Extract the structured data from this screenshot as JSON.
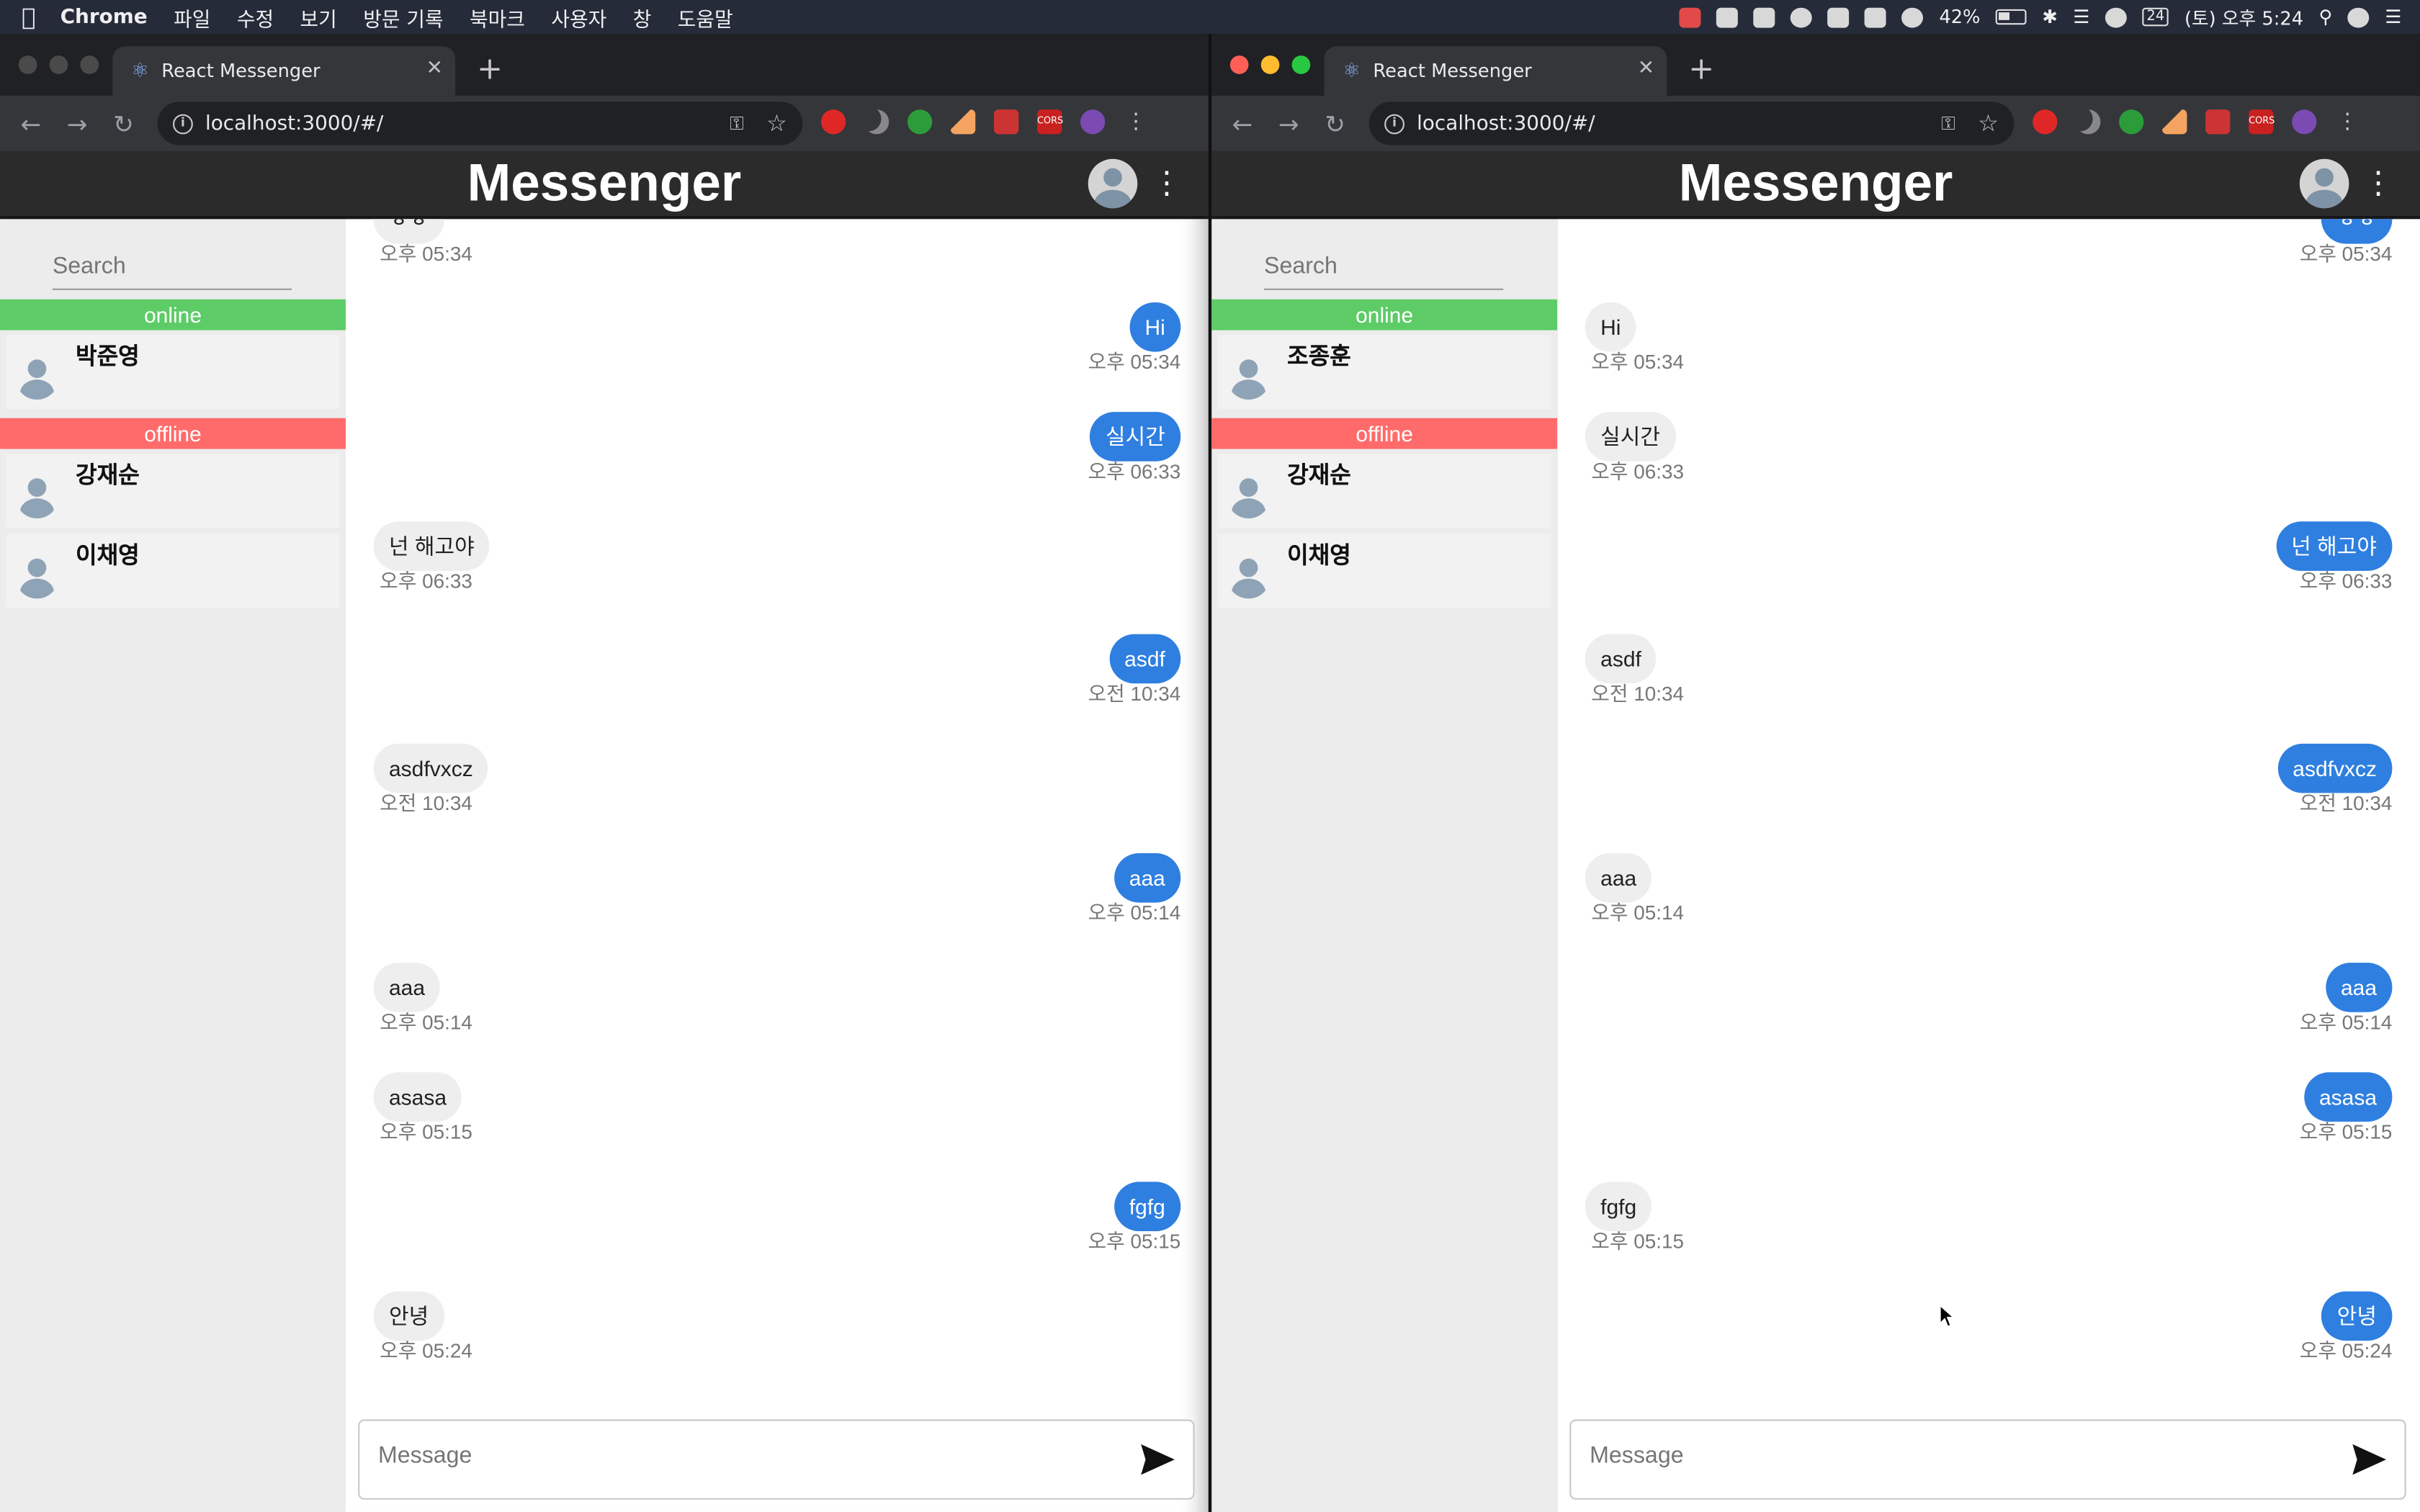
{
  "menubar": {
    "app_name": "Chrome",
    "items": [
      "파일",
      "수정",
      "보기",
      "방문 기록",
      "북마크",
      "사용자",
      "창",
      "도움말"
    ],
    "battery": "42%",
    "clock": "(토) 오후 5:24",
    "calendar_day": "24"
  },
  "windows": [
    {
      "tab_title": "React Messenger",
      "url": "localhost:3000/#/",
      "app_title": "Messenger",
      "search_placeholder": "Search",
      "online_label": "online",
      "offline_label": "offline",
      "online_contacts": [
        "박준영"
      ],
      "offline_contacts": [
        "강재순",
        "이채영"
      ],
      "composer_placeholder": "Message",
      "messages": [
        {
          "text": "ㅎㅎ",
          "time": "오후 05:34",
          "side": "recv"
        },
        {
          "text": "Hi",
          "time": "오후 05:34",
          "side": "sent"
        },
        {
          "text": "실시간",
          "time": "오후 06:33",
          "side": "sent"
        },
        {
          "text": "넌 해고야",
          "time": "오후 06:33",
          "side": "recv"
        },
        {
          "text": "asdf",
          "time": "오전 10:34",
          "side": "sent"
        },
        {
          "text": "asdfvxcz",
          "time": "오전 10:34",
          "side": "recv"
        },
        {
          "text": "aaa",
          "time": "오후 05:14",
          "side": "sent"
        },
        {
          "text": "aaa",
          "time": "오후 05:14",
          "side": "recv"
        },
        {
          "text": "asasa",
          "time": "오후 05:15",
          "side": "recv"
        },
        {
          "text": "fgfg",
          "time": "오후 05:15",
          "side": "sent"
        },
        {
          "text": "안녕",
          "time": "오후 05:24",
          "side": "recv"
        }
      ]
    },
    {
      "tab_title": "React Messenger",
      "url": "localhost:3000/#/",
      "app_title": "Messenger",
      "search_placeholder": "Search",
      "online_label": "online",
      "offline_label": "offline",
      "online_contacts": [
        "조종훈"
      ],
      "offline_contacts": [
        "강재순",
        "이채영"
      ],
      "composer_placeholder": "Message",
      "messages": [
        {
          "text": "ㅎㅎ",
          "time": "오후 05:34",
          "side": "sent"
        },
        {
          "text": "Hi",
          "time": "오후 05:34",
          "side": "recv"
        },
        {
          "text": "실시간",
          "time": "오후 06:33",
          "side": "recv"
        },
        {
          "text": "넌 해고야",
          "time": "오후 06:33",
          "side": "sent"
        },
        {
          "text": "asdf",
          "time": "오전 10:34",
          "side": "recv"
        },
        {
          "text": "asdfvxcz",
          "time": "오전 10:34",
          "side": "sent"
        },
        {
          "text": "aaa",
          "time": "오후 05:14",
          "side": "recv"
        },
        {
          "text": "aaa",
          "time": "오후 05:14",
          "side": "sent"
        },
        {
          "text": "asasa",
          "time": "오후 05:15",
          "side": "sent"
        },
        {
          "text": "fgfg",
          "time": "오후 05:15",
          "side": "recv"
        },
        {
          "text": "안녕",
          "time": "오후 05:24",
          "side": "sent"
        }
      ]
    }
  ],
  "colors": {
    "sent_bubble": "#2f7fe0",
    "recv_bubble": "#eeeeee",
    "online": "#5dcc67",
    "offline": "#ff6b6b",
    "header": "#2b2b2b"
  }
}
